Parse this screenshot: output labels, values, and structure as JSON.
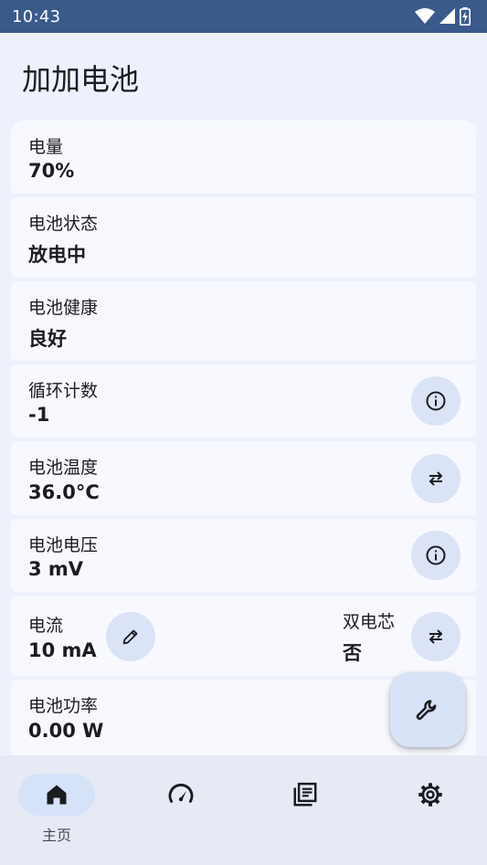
{
  "status_bar": {
    "time": "10:43",
    "icons": [
      "wifi-icon",
      "signal-icon",
      "battery-charging-icon"
    ]
  },
  "app": {
    "title": "加加电池"
  },
  "cards": [
    {
      "label": "电量",
      "value": "70%"
    },
    {
      "label": "电池状态",
      "value": "放电中"
    },
    {
      "label": "电池健康",
      "value": "良好"
    },
    {
      "label": "循环计数",
      "value": "-1",
      "action_icon": "info-icon"
    },
    {
      "label": "电池温度",
      "value": "36.0°C",
      "action_icon": "swap-icon"
    },
    {
      "label": "电池电压",
      "value": "3 mV",
      "action_icon": "info-icon"
    },
    {
      "label": "电流",
      "value": "10 mA",
      "edit_icon": "pencil-icon",
      "extra_label": "双电芯",
      "extra_value": "否",
      "action_icon": "swap-icon"
    },
    {
      "label": "电池功率",
      "value": "0.00 W"
    }
  ],
  "fab": {
    "icon": "wrench-icon"
  },
  "bottom_nav": [
    {
      "icon": "home-icon",
      "label": "主页",
      "active": true
    },
    {
      "icon": "speedometer-icon",
      "label": ""
    },
    {
      "icon": "article-icon",
      "label": ""
    },
    {
      "icon": "gear-icon",
      "label": ""
    }
  ],
  "colors": {
    "status_bar": "#3a5a8c",
    "background": "#eef1fb",
    "card": "#f8f9ff",
    "button": "#dbe3f6",
    "nav_active": "#d6e2f7"
  }
}
